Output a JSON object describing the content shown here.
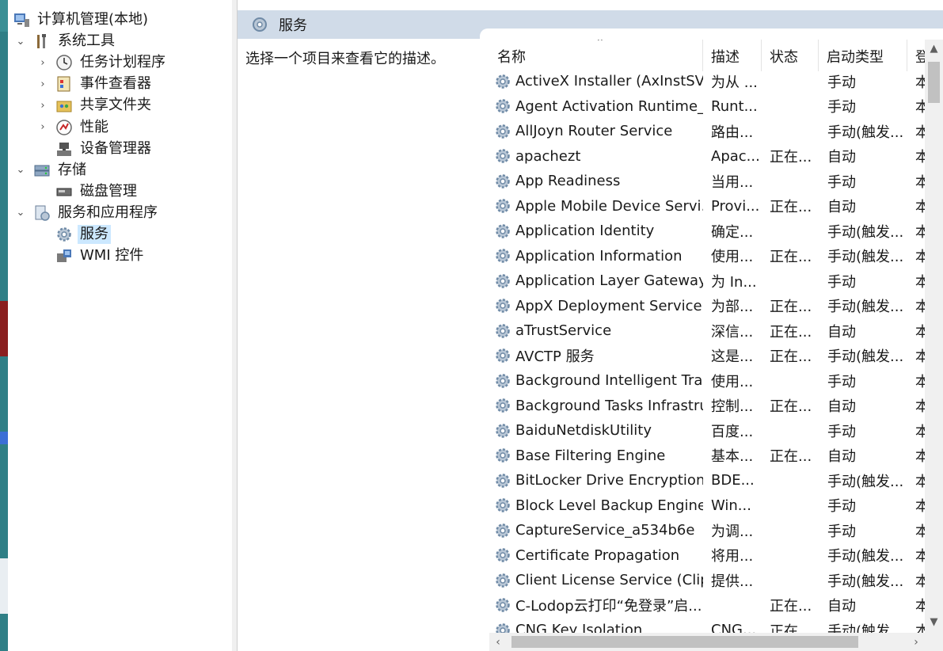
{
  "tree": {
    "items": [
      {
        "label": "计算机管理(本地)",
        "icon": "computer-management-icon",
        "level": 0,
        "expand": "none",
        "selected": false
      },
      {
        "label": "系统工具",
        "icon": "tools-icon",
        "level": 1,
        "expand": "expanded",
        "selected": false
      },
      {
        "label": "任务计划程序",
        "icon": "clock-icon",
        "level": 2,
        "expand": "collapsed",
        "selected": false
      },
      {
        "label": "事件查看器",
        "icon": "event-viewer-icon",
        "level": 2,
        "expand": "collapsed",
        "selected": false
      },
      {
        "label": "共享文件夹",
        "icon": "shared-folder-icon",
        "level": 2,
        "expand": "collapsed",
        "selected": false
      },
      {
        "label": "性能",
        "icon": "performance-icon",
        "level": 2,
        "expand": "collapsed",
        "selected": false
      },
      {
        "label": "设备管理器",
        "icon": "device-manager-icon",
        "level": 2,
        "expand": "none",
        "selected": false
      },
      {
        "label": "存储",
        "icon": "storage-icon",
        "level": 1,
        "expand": "expanded",
        "selected": false
      },
      {
        "label": "磁盘管理",
        "icon": "disk-icon",
        "level": 2,
        "expand": "none",
        "selected": false
      },
      {
        "label": "服务和应用程序",
        "icon": "services-apps-icon",
        "level": 1,
        "expand": "expanded",
        "selected": false
      },
      {
        "label": "服务",
        "icon": "gear-icon",
        "level": 2,
        "expand": "none",
        "selected": true
      },
      {
        "label": "WMI 控件",
        "icon": "wmi-icon",
        "level": 2,
        "expand": "none",
        "selected": false
      }
    ]
  },
  "header": {
    "title": "服务"
  },
  "description_hint": "选择一个项目来查看它的描述。",
  "columns": {
    "name": "名称",
    "desc": "描述",
    "status": "状态",
    "startup": "启动类型",
    "logon": "登"
  },
  "services": [
    {
      "name": "ActiveX Installer (AxInstSV)",
      "desc": "为从 ...",
      "status": "",
      "startup": "手动",
      "logon": "本"
    },
    {
      "name": "Agent Activation Runtime_...",
      "desc": "Runt...",
      "status": "",
      "startup": "手动",
      "logon": "本"
    },
    {
      "name": "AllJoyn Router Service",
      "desc": "路由...",
      "status": "",
      "startup": "手动(触发...",
      "logon": "本"
    },
    {
      "name": "apachezt",
      "desc": "Apac...",
      "status": "正在...",
      "startup": "自动",
      "logon": "本"
    },
    {
      "name": "App Readiness",
      "desc": "当用...",
      "status": "",
      "startup": "手动",
      "logon": "本"
    },
    {
      "name": "Apple Mobile Device Servi...",
      "desc": "Provi...",
      "status": "正在...",
      "startup": "自动",
      "logon": "本"
    },
    {
      "name": "Application Identity",
      "desc": "确定...",
      "status": "",
      "startup": "手动(触发...",
      "logon": "本"
    },
    {
      "name": "Application Information",
      "desc": "使用...",
      "status": "正在...",
      "startup": "手动(触发...",
      "logon": "本"
    },
    {
      "name": "Application Layer Gateway ...",
      "desc": "为 In...",
      "status": "",
      "startup": "手动",
      "logon": "本"
    },
    {
      "name": "AppX Deployment Service ...",
      "desc": "为部...",
      "status": "正在...",
      "startup": "手动(触发...",
      "logon": "本"
    },
    {
      "name": "aTrustService",
      "desc": "深信...",
      "status": "正在...",
      "startup": "自动",
      "logon": "本"
    },
    {
      "name": "AVCTP 服务",
      "desc": "这是...",
      "status": "正在...",
      "startup": "手动(触发...",
      "logon": "本"
    },
    {
      "name": "Background Intelligent Tra...",
      "desc": "使用...",
      "status": "",
      "startup": "手动",
      "logon": "本"
    },
    {
      "name": "Background Tasks Infrastru...",
      "desc": "控制...",
      "status": "正在...",
      "startup": "自动",
      "logon": "本"
    },
    {
      "name": "BaiduNetdiskUtility",
      "desc": "百度...",
      "status": "",
      "startup": "手动",
      "logon": "本"
    },
    {
      "name": "Base Filtering Engine",
      "desc": "基本...",
      "status": "正在...",
      "startup": "自动",
      "logon": "本"
    },
    {
      "name": "BitLocker Drive Encryption ...",
      "desc": "BDE...",
      "status": "",
      "startup": "手动(触发...",
      "logon": "本"
    },
    {
      "name": "Block Level Backup Engine ...",
      "desc": "Win...",
      "status": "",
      "startup": "手动",
      "logon": "本"
    },
    {
      "name": "CaptureService_a534b6e",
      "desc": "为调...",
      "status": "",
      "startup": "手动",
      "logon": "本"
    },
    {
      "name": "Certificate Propagation",
      "desc": "将用...",
      "status": "",
      "startup": "手动(触发...",
      "logon": "本"
    },
    {
      "name": "Client License Service (Clip...",
      "desc": "提供...",
      "status": "",
      "startup": "手动(触发...",
      "logon": "本"
    },
    {
      "name": "C-Lodop云打印“免登录”启...",
      "desc": "",
      "status": "正在...",
      "startup": "自动",
      "logon": "本"
    },
    {
      "name": "CNG Key Isolation",
      "desc": "CNG...",
      "status": "正在...",
      "startup": "手动(触发...",
      "logon": "本"
    }
  ],
  "colors": {
    "header_bg": "#d0dbe8",
    "selected_bg": "#cce8ff",
    "desktop": "#2f7f86"
  }
}
